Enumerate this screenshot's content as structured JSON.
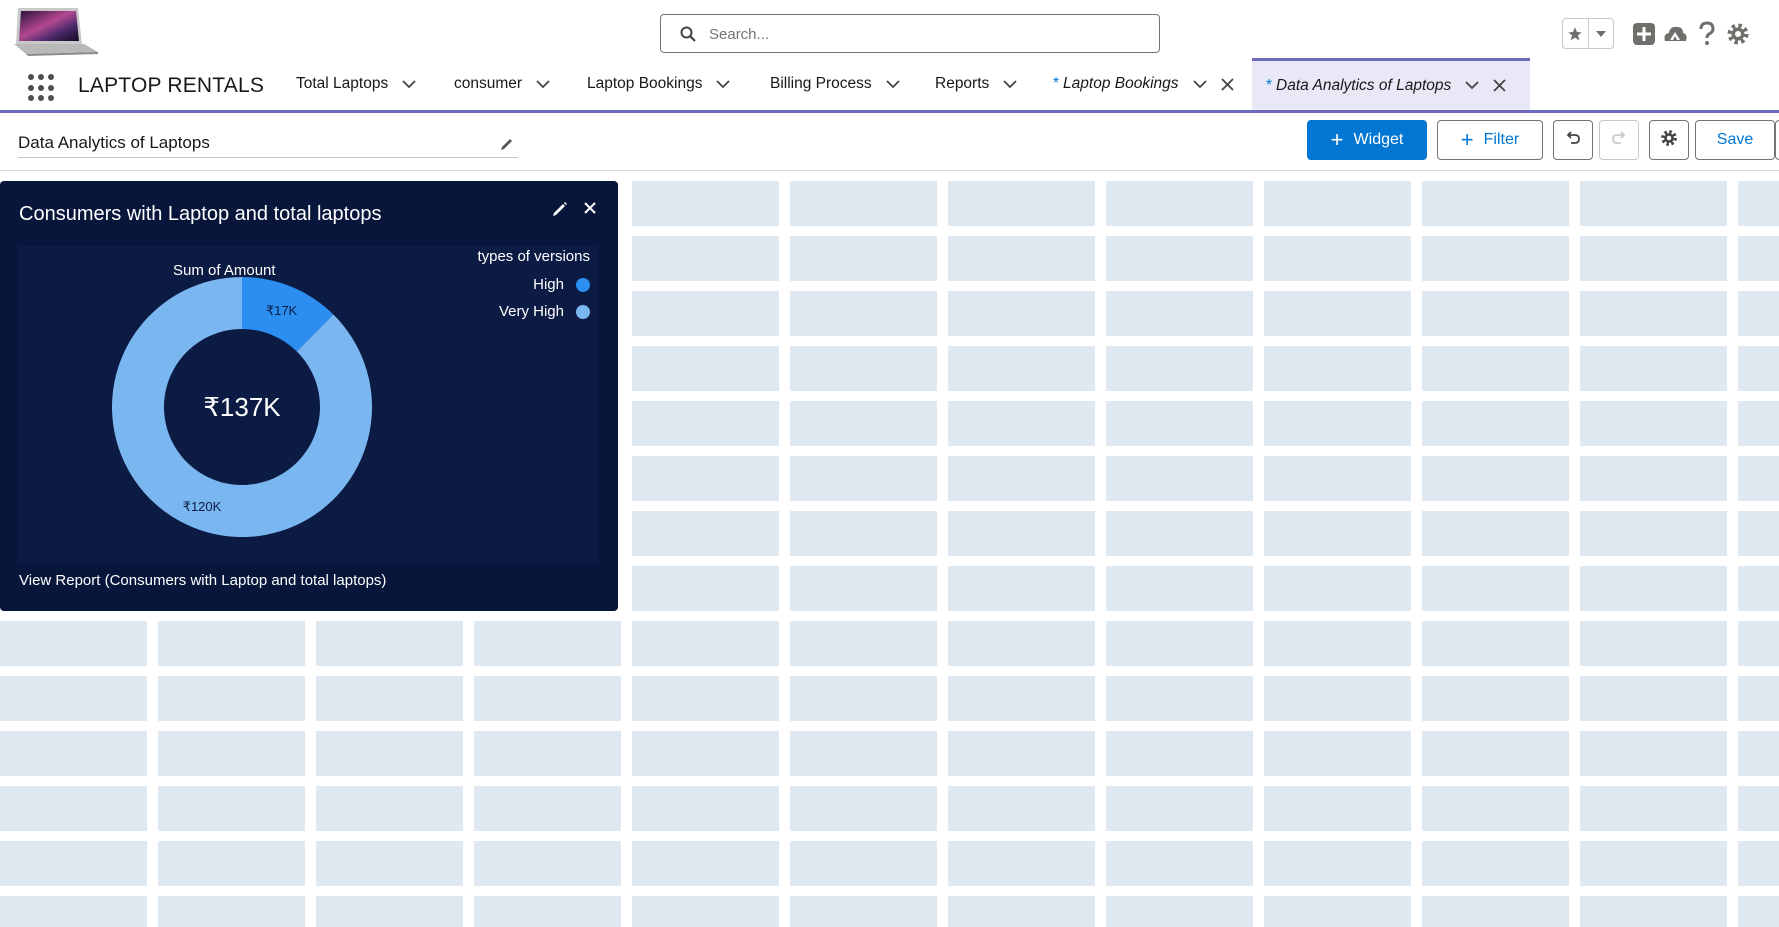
{
  "header": {
    "search_placeholder": "Search..."
  },
  "nav": {
    "app_name": "LAPTOP RENTALS",
    "tabs": [
      {
        "label": "Total Laptops"
      },
      {
        "label": "consumer"
      },
      {
        "label": "Laptop Bookings"
      },
      {
        "label": "Billing Process"
      },
      {
        "label": "Reports"
      },
      {
        "label": "Laptop Bookings",
        "unsaved_marker": "*"
      },
      {
        "label": "Data Analytics of Laptops",
        "unsaved_marker": "*"
      }
    ]
  },
  "toolbar": {
    "dashboard_title": "Data Analytics of Laptops",
    "widget_label": "Widget",
    "filter_label": "Filter",
    "save_label": "Save"
  },
  "widget": {
    "title": "Consumers with Laptop and total laptops",
    "footer_link": "View Report (Consumers with Laptop and total laptops)"
  },
  "chart_data": {
    "type": "pie",
    "variant": "donut",
    "title": "Sum of Amount",
    "center_label": "₹137K",
    "legend_title": "types of versions",
    "legend_position": "top-right",
    "categories": [
      "High",
      "Very High"
    ],
    "values": [
      17,
      120
    ],
    "value_labels": [
      "₹17K",
      "₹120K"
    ],
    "unit": "₹K",
    "colors": [
      "#2b8ef0",
      "#7ab7f0"
    ]
  },
  "colors": {
    "brand": "#0176d3",
    "nav_accent": "#6e6bbf",
    "widget_bg": "#07163a",
    "grid_cell": "#dfe7f1"
  }
}
